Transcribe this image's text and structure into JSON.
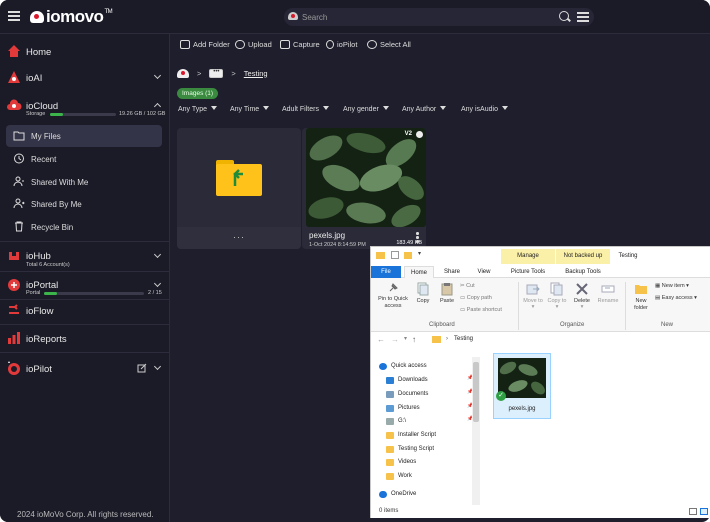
{
  "app": {
    "logo_text": "iomovo",
    "logo_tm": "TM"
  },
  "search": {
    "placeholder": "Search"
  },
  "sidebar": {
    "home": "Home",
    "ioai": "ioAI",
    "iocloud": "ioCloud",
    "storage_label": "Storage",
    "storage_value": "19.26 GB / 102 GB",
    "storage_fraction": 0.19,
    "my_files": "My Files",
    "recent": "Recent",
    "shared_with_me": "Shared With Me",
    "shared_by_me": "Shared By Me",
    "recycle_bin": "Recycle Bin",
    "iohub": "ioHub",
    "iohub_sub": "Total 6 Account(s)",
    "ioportal": "ioPortal",
    "portal_label": "Portal",
    "portal_value": "2 / 15",
    "portal_fraction": 0.13,
    "ioflow": "ioFlow",
    "ioreports": "ioReports",
    "iopilot": "ioPilot",
    "copyright": "2024 ioMoVo Corp. All rights reserved."
  },
  "toolbar": {
    "add_folder": "Add Folder",
    "upload": "Upload",
    "capture": "Capture",
    "iopilot": "ioPilot",
    "select_all": "Select All"
  },
  "breadcrumb": {
    "box": "•••",
    "current": "Testing",
    "sep": ">"
  },
  "badge": "Images (1)",
  "filters": [
    "Any Type",
    "Any Time",
    "Adult Filters",
    "Any gender",
    "Any Author",
    "Any isAudio"
  ],
  "folder_card": {
    "more": "···"
  },
  "image_card": {
    "version": "V2",
    "size": "183.49 KB",
    "name": "pexels.jpg",
    "date": "1-Oct 2024 8:14:59 PM"
  },
  "explorer": {
    "ctx_manage": "Manage",
    "ctx_backup": "Not backed up",
    "title": "Testing",
    "tabs": [
      "File",
      "Home",
      "Share",
      "View",
      "Picture Tools",
      "Backup Tools"
    ],
    "ribbon": {
      "pin": "Pin to Quick access",
      "copy": "Copy",
      "paste": "Paste",
      "cut": "Cut",
      "copy_path": "Copy path",
      "paste_shortcut": "Paste shortcut",
      "move_to": "Move to",
      "copy_to": "Copy to",
      "delete": "Delete",
      "rename": "Rename",
      "new_folder": "New folder",
      "new_item": "New item",
      "easy_access": "Easy access",
      "grp_clipboard": "Clipboard",
      "grp_organize": "Organize",
      "grp_new": "New"
    },
    "address": "Testing",
    "nav": [
      "Quick access",
      "Downloads",
      "Documents",
      "Pictures",
      "G:\\",
      "Installer Script",
      "Testing Script",
      "Videos",
      "Work",
      "OneDrive"
    ],
    "file_name": "pexels.jpg",
    "status": "0 items"
  }
}
